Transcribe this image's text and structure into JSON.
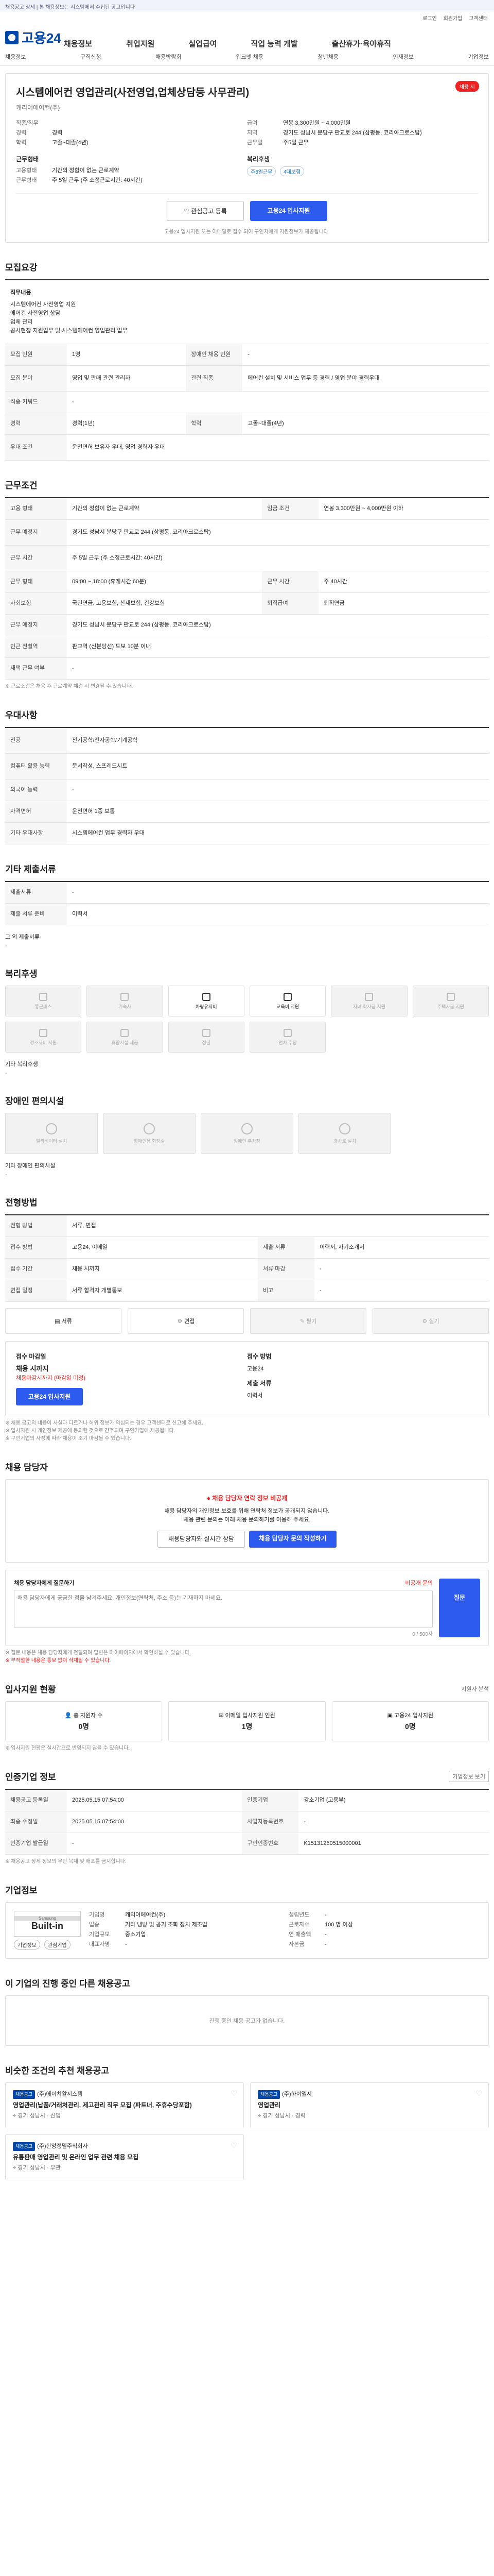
{
  "topbar": {
    "text": "채용공고 상세 | 본 채용정보는 시스템에서 수집된 공고입니다"
  },
  "util": {
    "login": "로그인",
    "join": "회원가입",
    "center": "고객센터"
  },
  "header": {
    "logo": "고용24",
    "gnb": [
      "채용정보",
      "취업지원",
      "실업급여",
      "직업 능력 개발",
      "출산휴가·육아휴직"
    ],
    "sub": [
      "채용정보",
      "구직신청",
      "채용박람회",
      "워크넷 채용",
      "청년채용",
      "인재정보",
      "기업정보"
    ]
  },
  "ad": {
    "title": "시스템에어컨 영업관리(사전영업,업체상담등 사무관리)",
    "badge": "채용 시",
    "company": "캐리어에어컨(주)",
    "left": [
      {
        "k": "직종/직무",
        "v": ""
      },
      {
        "k": "경력",
        "v": "경력"
      },
      {
        "k": "학력",
        "v": "고졸~대졸(4년)"
      }
    ],
    "right": [
      {
        "k": "급여",
        "v": "연봉 3,300만원 ~ 4,000만원"
      },
      {
        "k": "지역",
        "v": "경기도 성남시 분당구 판교로 244 (삼평동, 코리아크로스탑)"
      },
      {
        "k": "근무일",
        "v": "주5일 근무"
      }
    ],
    "work_title": "근무형태",
    "work": [
      {
        "k": "고용형태",
        "v": "기간의 정함이 없는 근로계약"
      },
      {
        "k": "근무형태",
        "v": "주 5일 근무 (주 소정근로시간: 40시간)"
      }
    ],
    "cond_title": "복리후생",
    "chips": [
      "주5일근무",
      "4대보험"
    ],
    "interest_btn": "관심공고 등록",
    "apply_btn": "고용24 입사지원",
    "note": "고용24 입사지원 또는 이메일로 접수 되어 구인자에게 지원정보가 제공됩니다."
  },
  "recruit": {
    "title": "모집요강",
    "duty_label": "직무내용",
    "duty_lines": [
      "시스템에어컨 사전영업 지원",
      "에어컨 사전영업 상담",
      "업체 관리",
      "공사현장 지원업무 및 시스템에어컨 영업관리 업무"
    ],
    "rows": [
      {
        "k1": "모집 인원",
        "v1": "1명",
        "k2": "장애인 채용 인원",
        "v2": "-"
      },
      {
        "k1": "모집 분야",
        "v1": "영업 및 판매 관련 관리자",
        "k2": "관련 직종",
        "v2": "에어컨 설치 및 서비스 업무 등 경력 / 영업 분야 경력우대"
      },
      {
        "k1": "직종 키워드",
        "v1": "-",
        "k2": "",
        "v2": ""
      },
      {
        "k1": "경력",
        "v1": "경력(1년)",
        "k2": "학력",
        "v2": "고졸~대졸(4년)"
      },
      {
        "k1": "우대 조건",
        "v1": "운전면허 보유자 우대, 영업 경력자 우대",
        "k2": "",
        "v2": ""
      }
    ]
  },
  "condition": {
    "title": "근무조건",
    "rows": [
      {
        "k1": "고용 형태",
        "v1": "기간의 정함이 없는 근로계약",
        "k2": "임금 조건",
        "v2": "연봉 3,300만원 ~ 4,000만원 이하"
      },
      {
        "k1": "근무 예정지",
        "v1": "경기도 성남시 분당구 판교로 244 (삼평동, 코리아크로스탑)",
        "k2": "",
        "v2": ""
      },
      {
        "k1": "근무 시간",
        "v1": "주 5일 근무 (주 소정근로시간: 40시간)",
        "k2": "",
        "v2": ""
      },
      {
        "k1": "근무 형태",
        "v1": "09:00 ~ 18:00 (휴게시간 60분)",
        "k2": "근무 시간",
        "v2": "주 40시간"
      },
      {
        "k1": "사회보험",
        "v1": "국민연금, 고용보험, 산재보험, 건강보험",
        "k2": "퇴직급여",
        "v2": "퇴직연금"
      },
      {
        "k1": "근무 예정지",
        "v1": "경기도 성남시 분당구 판교로 244 (삼평동, 코리아크로스탑)",
        "k2": "",
        "v2": ""
      },
      {
        "k1": "인근 전철역",
        "v1": "판교역 (신분당선) 도보 10분 이내",
        "k2": "",
        "v2": ""
      },
      {
        "k1": "재택 근무 여부",
        "v1": "-",
        "k2": "",
        "v2": ""
      }
    ],
    "note": "※ 근로조건은 채용 후 근로계약 체결 시 변경될 수 있습니다."
  },
  "preference": {
    "title": "우대사항",
    "rows": [
      {
        "k": "전공",
        "v": "전기공학/전자공학/기계공학"
      },
      {
        "k": "컴퓨터 활용 능력",
        "v": "문서작성, 스프레드시트"
      },
      {
        "k": "외국어 능력",
        "v": "-"
      },
      {
        "k": "자격면허",
        "v": "운전면허 1종 보통"
      },
      {
        "k": "기타 우대사항",
        "v": "시스템에어컨 업무 경력자 우대"
      }
    ]
  },
  "disabled": {
    "title": "기타 제출서류",
    "rows": [
      {
        "k": "제출서류",
        "v": "-"
      },
      {
        "k": "제출 서류 준비",
        "v": "이력서"
      }
    ],
    "empty": "그 외 제출서류",
    "empty_val": "-"
  },
  "welfare": {
    "title": "복리후생",
    "items": [
      "통근버스",
      "기숙사",
      "차량유지비",
      "교육비 지원",
      "자녀 학자금 지원",
      "주택자금 지원",
      "경조사비 지원",
      "휴양시설 제공",
      "정년",
      "연차 수당"
    ],
    "active": [
      2,
      3
    ],
    "other_label": "기타 복리후생",
    "other_val": "-"
  },
  "disability": {
    "title": "장애인 편의시설",
    "items": [
      "엘리베이터 설치",
      "장애인용 화장실",
      "장애인 주차장",
      "경사로 설치"
    ],
    "other_label": "기타 장애인 편의시설",
    "other_val": "-"
  },
  "selection": {
    "title": "전형방법",
    "rows": [
      {
        "k1": "전형 방법",
        "v1": "서류, 면접",
        "k2": "",
        "v2": ""
      },
      {
        "k1": "접수 방법",
        "v1": "고용24, 이메일",
        "k2": "제출 서류",
        "v2": "이력서, 자기소개서"
      },
      {
        "k1": "접수 기간",
        "v1": "채용 시까지",
        "k2": "서류 마감",
        "v2": "-"
      },
      {
        "k1": "면접 일정",
        "v1": "서류 합격자 개별통보",
        "k2": "비고",
        "v2": "-"
      }
    ],
    "methods": [
      "서류",
      "면접",
      "필기",
      "실기"
    ],
    "methods_on": [
      0,
      1
    ]
  },
  "period": {
    "left_title": "접수 마감일",
    "left_val": "채용 시까지",
    "left_sub": "채용마감시까지 (마감일 미정)",
    "apply_btn": "고용24 입사지원",
    "right_title": "접수 방법",
    "right_val": "고용24",
    "right_title2": "제출 서류",
    "right_val2": "이력서",
    "notes": [
      "※ 채용 공고의 내용이 사실과 다르거나 허위 정보가 의심되는 경우 고객센터로 신고해 주세요.",
      "※ 입사지원 시 개인정보 제공에 동의한 것으로 간주되며 구인기업에 제공됩니다.",
      "※ 구인기업의 사정에 따라 채용이 조기 마감될 수 있습니다."
    ]
  },
  "contact": {
    "title": "채용 담당자",
    "warn": "채용 담당자 연락 정보 비공개",
    "lines": [
      "채용 담당자의 개인정보 보호를 위해 연락처 정보가 공개되지 않습니다.",
      "채용 관련 문의는 아래 채용 문의하기를 이용해 주세요."
    ],
    "btn1": "채용담당자와 실시간 상담",
    "btn2": "채용 담당자 문의 작성하기"
  },
  "qa": {
    "title": "채용 담당자에게 질문하기",
    "right": "비공개 문의",
    "placeholder": "채용 담당자에게 궁금한 점을 남겨주세요. 개인정보(연락처, 주소 등)는 기재하지 마세요.",
    "submit": "질문",
    "count": "0 / 500자",
    "notes": [
      "※ 질문 내용은 채용 담당자에게 전달되며 답변은 마이페이지에서 확인하실 수 있습니다.",
      "※ 부적절한 내용은 통보 없이 삭제될 수 있습니다."
    ]
  },
  "stats": {
    "title": "입사지원 현황",
    "more": "지원자 분석",
    "items": [
      {
        "label": "총 지원자 수",
        "value": "0명"
      },
      {
        "label": "이메일 입사지원 인원",
        "value": "1명"
      },
      {
        "label": "고용24 입사지원",
        "value": "0명"
      }
    ],
    "note": "※ 입사지원 현황은 실시간으로 반영되지 않을 수 있습니다."
  },
  "info": {
    "title": "인증기업 정보",
    "btn": "기업정보 보기",
    "rows": [
      {
        "k1": "채용공고 등록일",
        "v1": "2025.05.15 07:54:00",
        "k2": "인증기업",
        "v2": "강소기업 (고용부)"
      },
      {
        "k1": "최종 수정일",
        "v1": "2025.05.15 07:54:00",
        "k2": "사업자등록번호",
        "v2": "-"
      },
      {
        "k1": "인증기업 발급일",
        "v1": "-",
        "k2": "구인인증번호",
        "v2": "K15131250515000001"
      }
    ],
    "note": "※ 채용공고 상세 정보의 무단 복제 및 배포를 금지합니다."
  },
  "company": {
    "title": "기업정보",
    "logo_top": "Samsung",
    "logo_main": "Built-in",
    "btn1": "기업정보",
    "btn2": "관심기업",
    "rows": [
      {
        "k": "기업명",
        "v": "캐리어에어컨(주)"
      },
      {
        "k": "업종",
        "v": "기타 냉방 및 공기 조화 장치 제조업"
      },
      {
        "k": "기업규모",
        "v": "중소기업"
      },
      {
        "k": "대표자명",
        "v": "-"
      }
    ],
    "rows2": [
      {
        "k": "설립년도",
        "v": "-"
      },
      {
        "k": "근로자수",
        "v": "100 명 이상"
      },
      {
        "k": "연 매출액",
        "v": "-"
      },
      {
        "k": "자본금",
        "v": "-"
      }
    ]
  },
  "empty_list": {
    "title": "이 기업의 진행 중인 다른 채용공고",
    "text": "진행 중인 채용 공고가 없습니다."
  },
  "recommend": {
    "title": "비슷한 조건의 추천 채용공고",
    "items": [
      {
        "tag": "채용공고",
        "company": "(주)에이치알시스템",
        "title": "영업관리(납품/거래처관리, 제고관리 직무 모집 (파트너, 주휴수당포함)",
        "loc": "경기 성남시",
        "etc": "신입"
      },
      {
        "tag": "채용공고",
        "company": "(주)하이엘시",
        "title": "영업관리",
        "loc": "경기 성남시",
        "etc": "경력"
      },
      {
        "tag": "채용공고",
        "company": "(주)한양정밀주식회사",
        "title": "유통판매 영업관리 및 온라인 업무 관련 채용 모집",
        "loc": "경기 성남시",
        "etc": "무관"
      }
    ]
  }
}
